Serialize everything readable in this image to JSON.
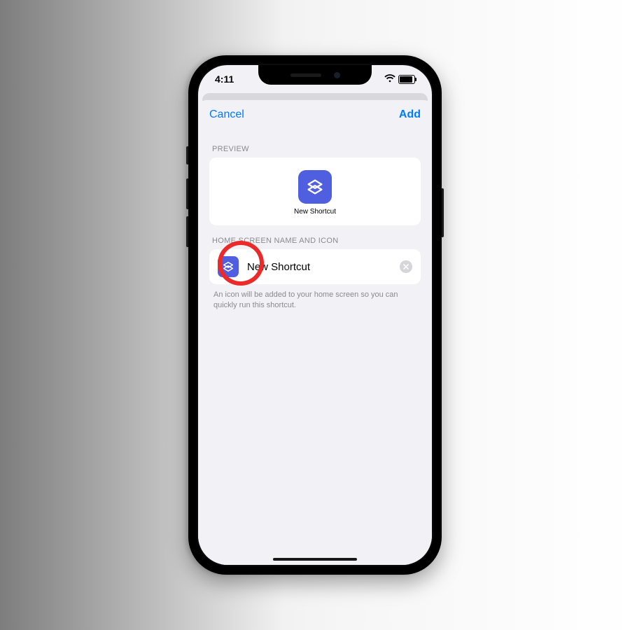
{
  "status": {
    "time": "4:11"
  },
  "nav": {
    "cancel": "Cancel",
    "add": "Add"
  },
  "sections": {
    "preview_label": "PREVIEW",
    "home_label": "HOME SCREEN NAME AND ICON"
  },
  "preview": {
    "app_name": "New Shortcut"
  },
  "home": {
    "name_value": "New Shortcut",
    "footer": "An icon will be added to your home screen so you can quickly run this shortcut."
  },
  "colors": {
    "accent": "#007aff",
    "icon_bg": "#4f5fe0"
  }
}
